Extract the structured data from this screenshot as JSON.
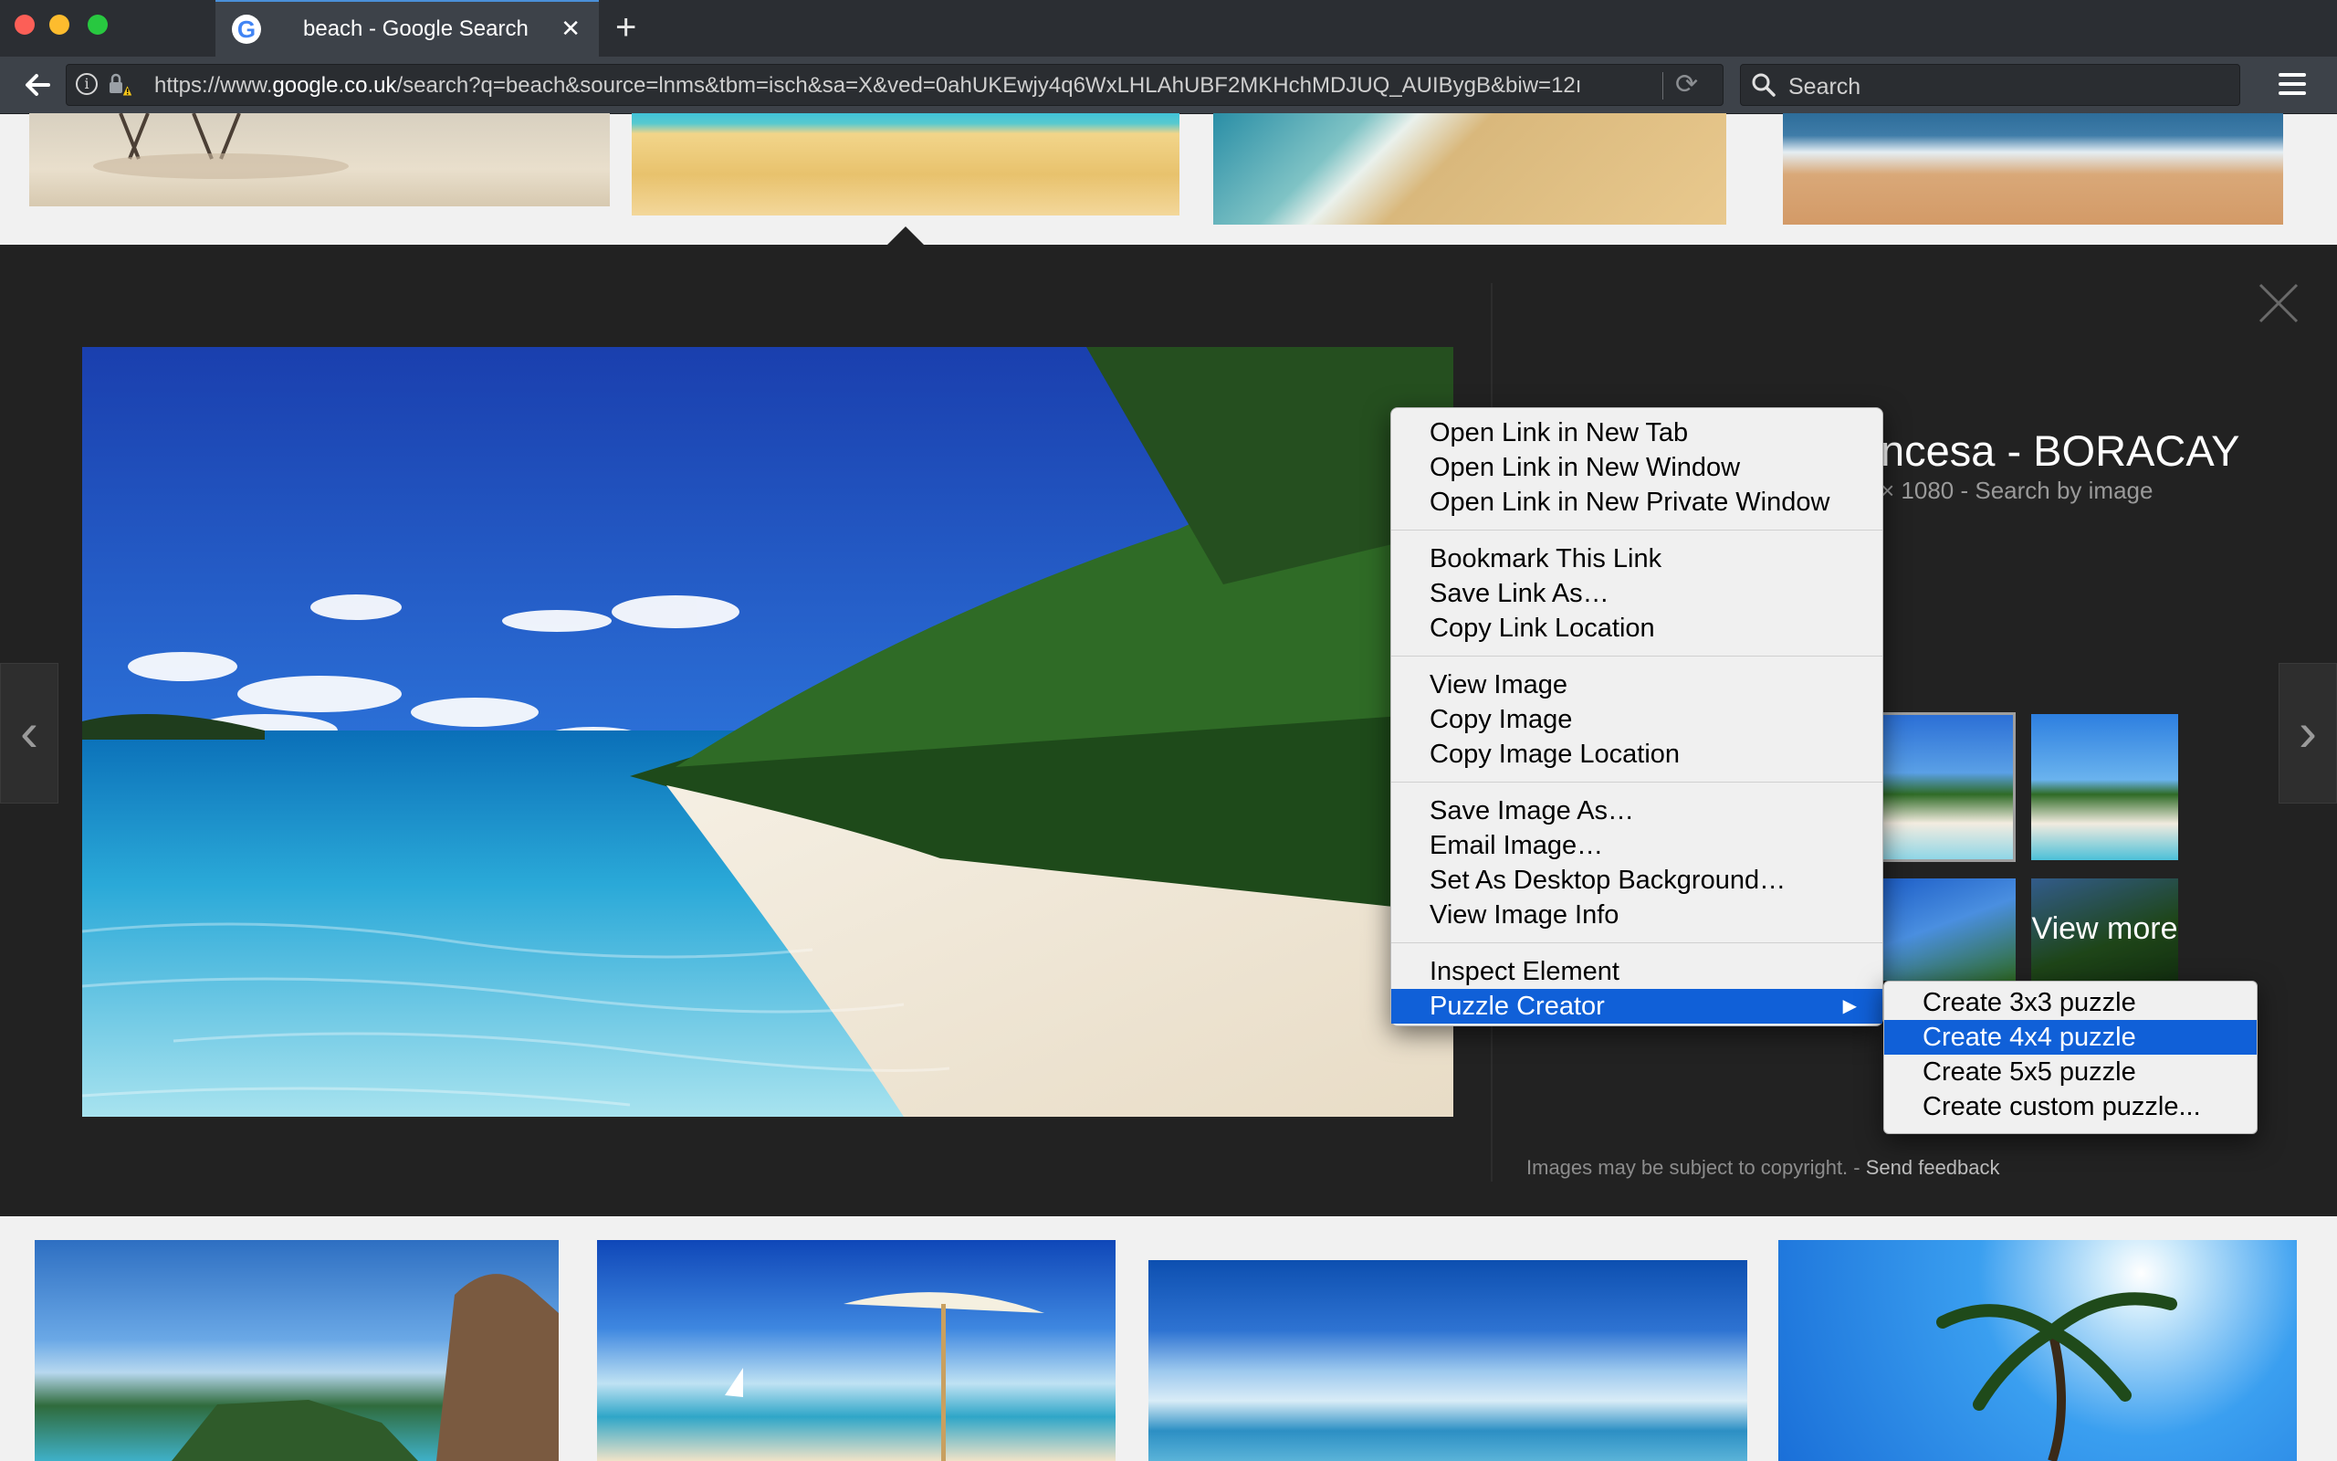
{
  "browser": {
    "tab_title": "beach - Google Search",
    "tab_favicon": "G",
    "new_tab_label": "+",
    "url_scheme": "https://www.",
    "url_host": "google.co.uk",
    "url_path": "/search?q=beach&source=lnms&tbm=isch&sa=X&ved=0ahUKEwjy4q6WxLHLAhUBF2MKHchMDJUQ_AUIBygB&biw=12ı",
    "search_placeholder": "Search"
  },
  "preview": {
    "title": "ncesa - BORACAY",
    "meta_size": "× 1080",
    "meta_sep": " - ",
    "search_by_image": "Search by image",
    "view_more": "View more",
    "copyright": "Images may be subject to copyright.",
    "copyright_sep": " - ",
    "send_feedback": "Send feedback"
  },
  "context_menu": {
    "group1": [
      "Open Link in New Tab",
      "Open Link in New Window",
      "Open Link in New Private Window"
    ],
    "group2": [
      "Bookmark This Link",
      "Save Link As…",
      "Copy Link Location"
    ],
    "group3": [
      "View Image",
      "Copy Image",
      "Copy Image Location"
    ],
    "group4": [
      "Save Image As…",
      "Email Image…",
      "Set As Desktop Background…",
      "View Image Info"
    ],
    "inspect": "Inspect Element",
    "puzzle": "Puzzle Creator"
  },
  "submenu": {
    "items": [
      "Create 3x3 puzzle",
      "Create 4x4 puzzle",
      "Create 5x5 puzzle",
      "Create custom puzzle..."
    ],
    "highlighted_index": 1
  },
  "colors": {
    "highlight": "#1060d8",
    "panel_bg": "#222222",
    "chrome_bg": "#3d4249"
  }
}
